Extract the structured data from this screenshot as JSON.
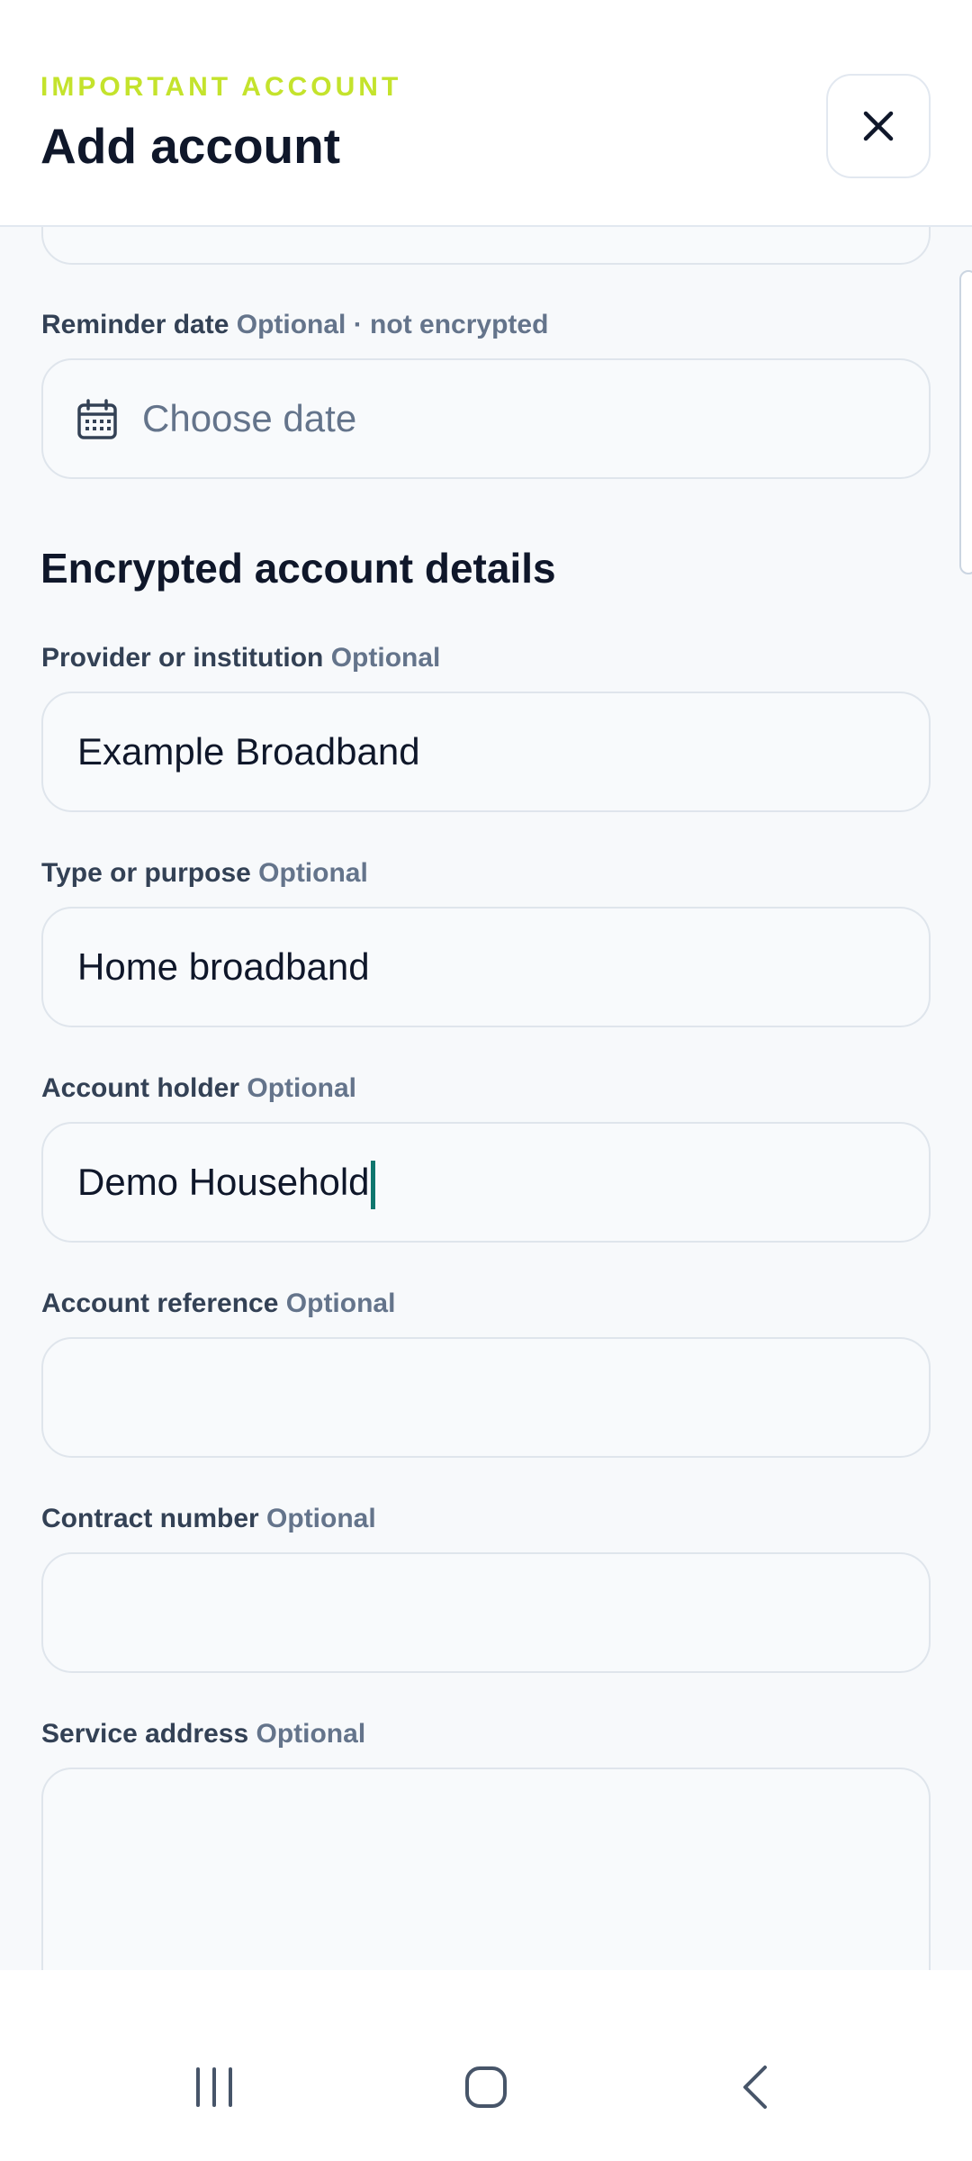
{
  "header": {
    "eyebrow": "IMPORTANT ACCOUNT",
    "title": "Add account",
    "close_icon": "close-icon"
  },
  "form": {
    "reminder": {
      "label": "Reminder date",
      "hint": "Optional · not encrypted",
      "placeholder": "Choose date",
      "icon": "calendar-icon"
    },
    "section_title": "Encrypted account details",
    "provider": {
      "label": "Provider or institution",
      "hint": "Optional",
      "value": "Example Broadband"
    },
    "type": {
      "label": "Type or purpose",
      "hint": "Optional",
      "value": "Home broadband"
    },
    "holder": {
      "label": "Account holder",
      "hint": "Optional",
      "value": "Demo Household"
    },
    "reference": {
      "label": "Account reference",
      "hint": "Optional",
      "value": ""
    },
    "contract": {
      "label": "Contract number",
      "hint": "Optional",
      "value": ""
    },
    "address": {
      "label": "Service address",
      "hint": "Optional",
      "value": ""
    }
  },
  "nav": {
    "recents_icon": "recents-icon",
    "home_icon": "home-icon",
    "back_icon": "back-icon"
  },
  "colors": {
    "accent": "#c4e32c",
    "caret": "#0f766e",
    "background": "#f7f9fb"
  }
}
